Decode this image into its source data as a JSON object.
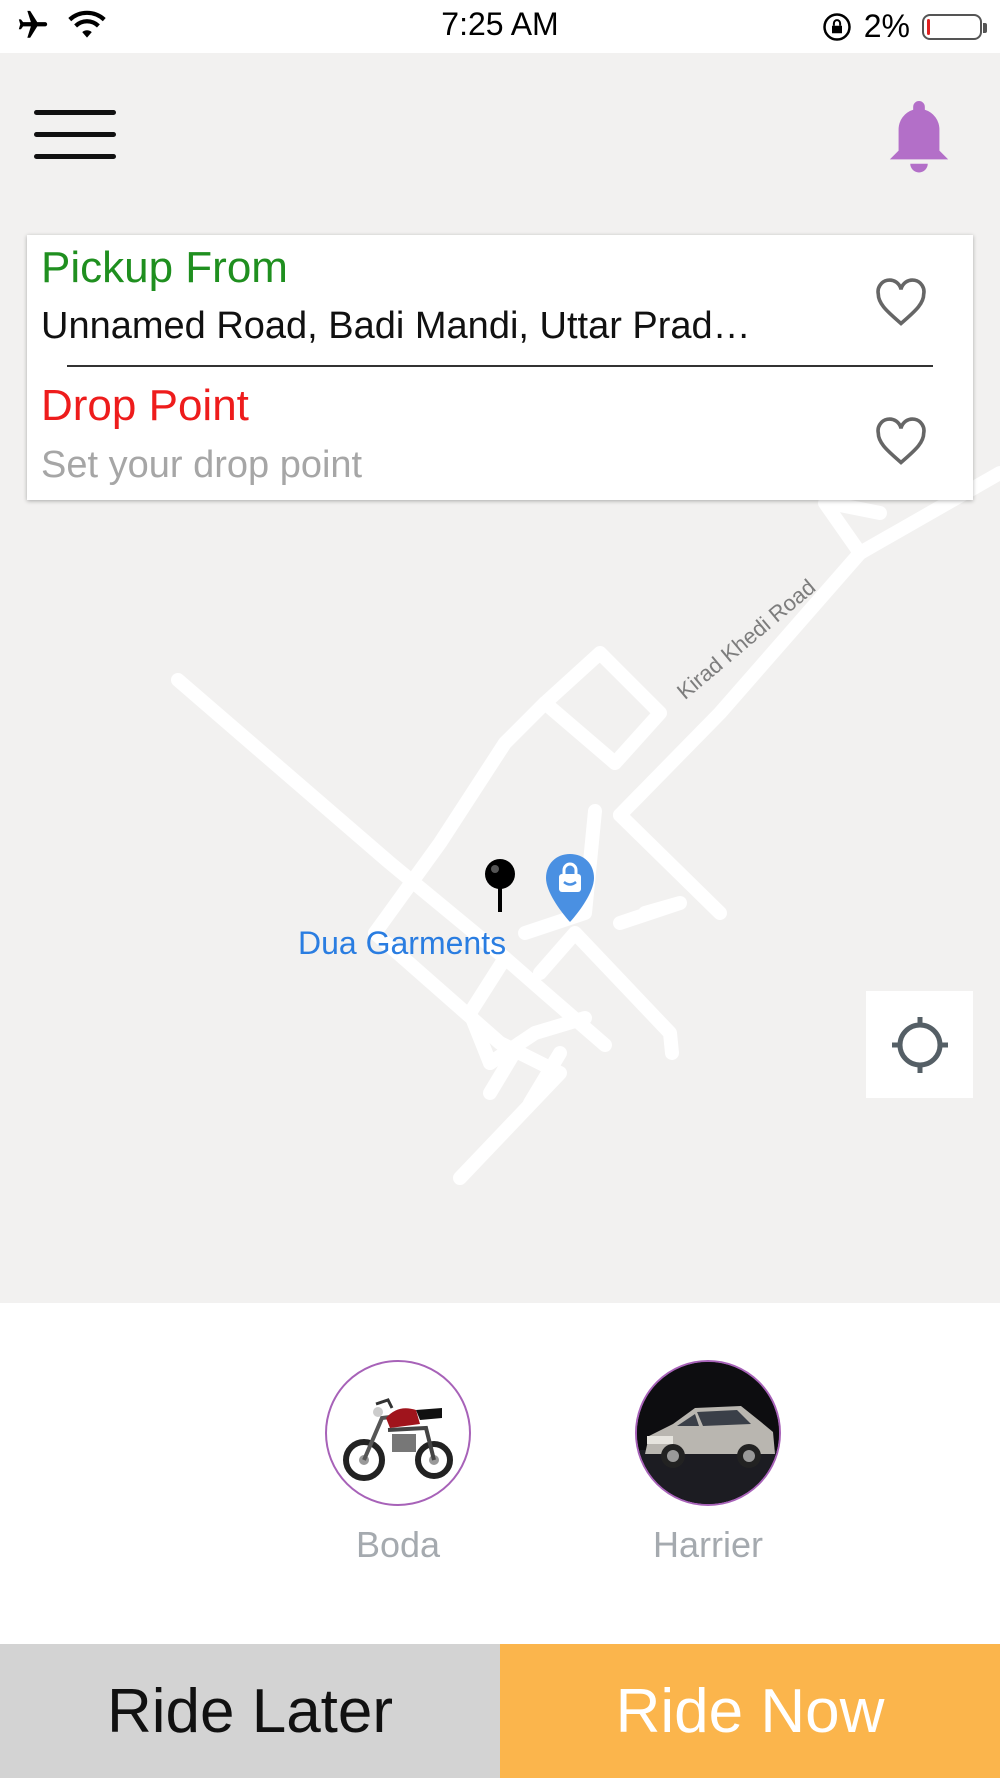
{
  "status_bar": {
    "time": "7:25 AM",
    "battery_percent": "2%",
    "battery_level": 0.02,
    "icons": [
      "airplane-mode-icon",
      "wifi-icon",
      "rotation-lock-icon",
      "battery-icon"
    ]
  },
  "header": {
    "menu_icon": "hamburger-menu-icon",
    "notification_icon": "bell-icon",
    "notification_color": "#b36fc8"
  },
  "address_card": {
    "pickup_title": "Pickup From",
    "pickup_value": "Unnamed Road, Badi Mandi, Uttar Prad…",
    "drop_title": "Drop Point",
    "drop_value": "",
    "drop_placeholder": "Set your drop point",
    "pickup_color": "#1f8f1f",
    "drop_color": "#ee1c1c"
  },
  "map": {
    "road_label": "Kirad Khedi Road",
    "place_label": "Dua Garments",
    "place_icon": "shopping-bag-pin-icon",
    "pin_icon": "location-pin-icon",
    "locate_icon": "crosshair-locate-icon"
  },
  "vehicles": [
    {
      "label": "Boda",
      "icon": "motorcycle-icon"
    },
    {
      "label": "Harrier",
      "icon": "car-icon"
    }
  ],
  "actions": {
    "ride_later": "Ride Later",
    "ride_now": "Ride Now",
    "ride_now_color": "#fbb54c"
  }
}
